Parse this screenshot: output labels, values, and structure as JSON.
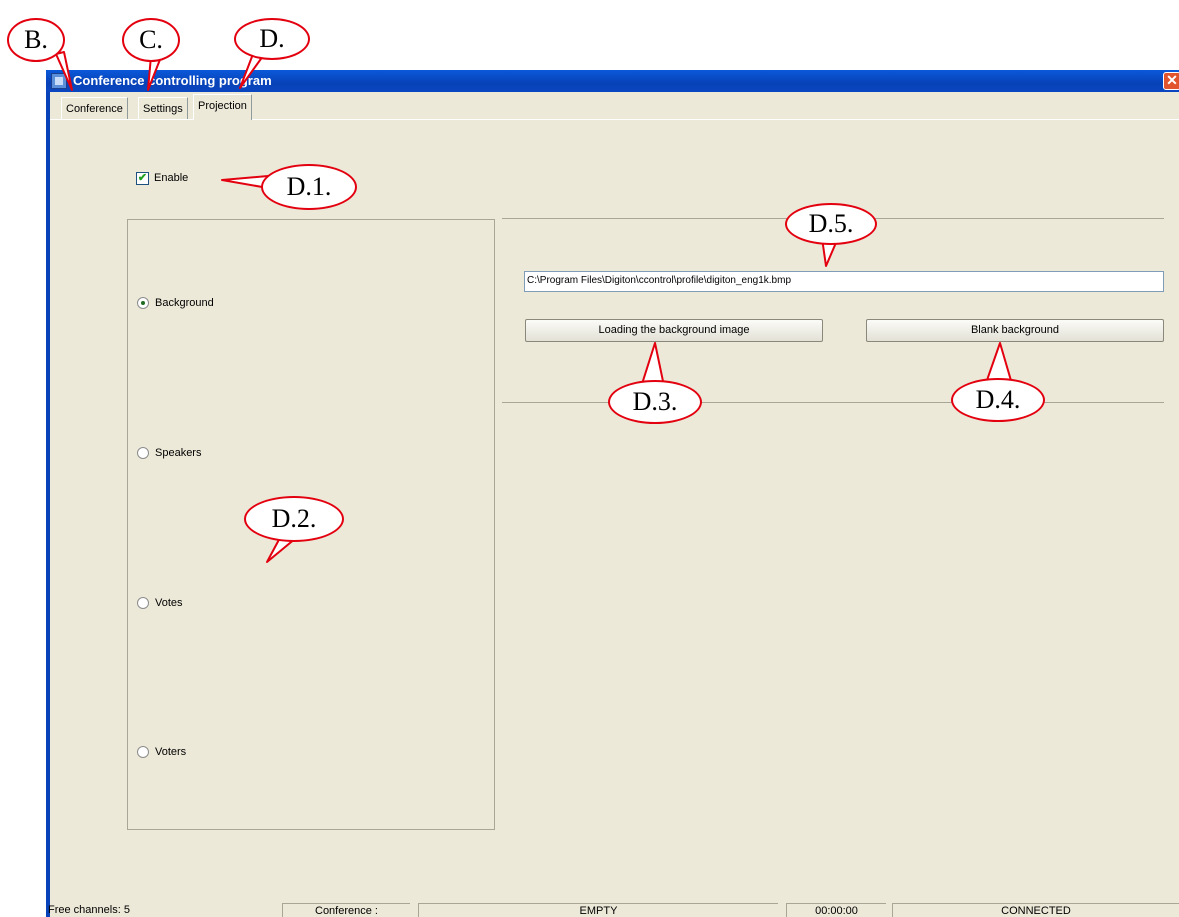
{
  "window": {
    "title": "Conference controlling program",
    "close_glyph": "✕"
  },
  "tabs": [
    {
      "label": "Conference",
      "active": false
    },
    {
      "label": "Settings",
      "active": false
    },
    {
      "label": "Projection",
      "active": true
    }
  ],
  "enable": {
    "label": "Enable",
    "checked": true,
    "mark": "✔"
  },
  "display_modes": {
    "options": [
      {
        "label": "Background",
        "checked": true
      },
      {
        "label": "Speakers",
        "checked": false
      },
      {
        "label": "Votes",
        "checked": false
      },
      {
        "label": "Voters",
        "checked": false
      }
    ]
  },
  "background": {
    "path_value": "C:\\Program Files\\Digiton\\ccontrol\\profile\\digiton_eng1k.bmp",
    "load_button": "Loading the background image",
    "blank_button": "Blank background"
  },
  "statusbar": {
    "free_channels": "Free channels: 5",
    "conference_label": "Conference :",
    "conference_state": "EMPTY",
    "time": "00:00:00",
    "connection": "CONNECTED"
  },
  "callouts": {
    "b": "B.",
    "c": "C.",
    "d": "D.",
    "d1": "D.1.",
    "d2": "D.2.",
    "d3": "D.3.",
    "d4": "D.4.",
    "d5": "D.5."
  },
  "colors": {
    "callout_border": "#e3000f",
    "titlebar": "#0a59d9",
    "window_bg": "#ece9d8"
  }
}
